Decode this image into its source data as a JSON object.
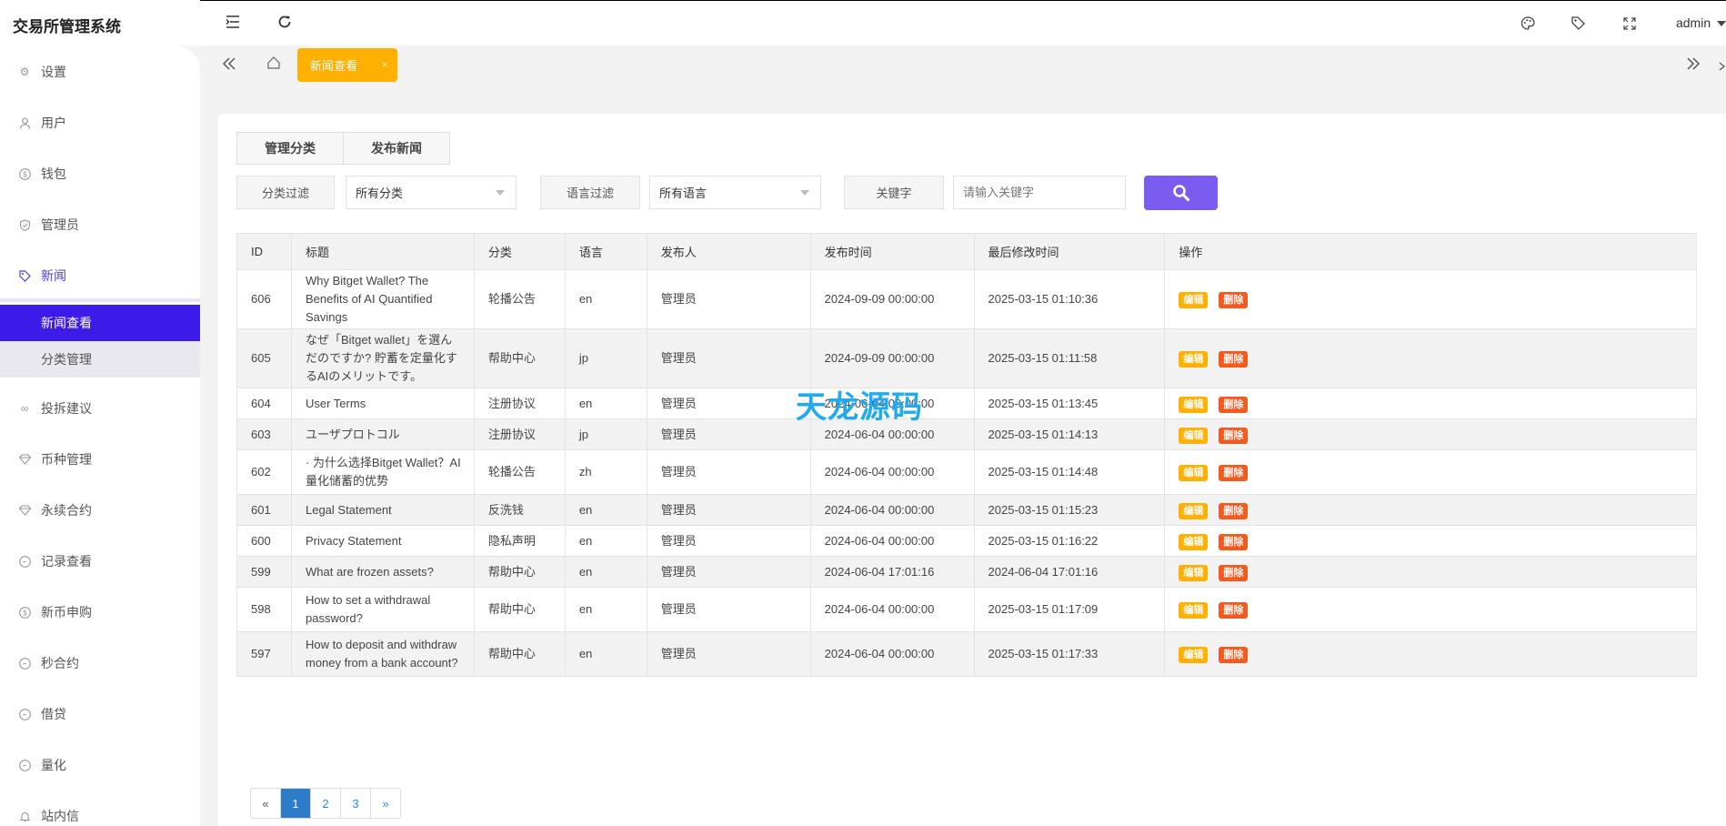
{
  "app": {
    "title": "交易所管理系统",
    "user": "admin"
  },
  "sidebar": {
    "items": [
      {
        "label": "设置",
        "icon": "gear-icon"
      },
      {
        "label": "用户",
        "icon": "user-icon"
      },
      {
        "label": "钱包",
        "icon": "dollar-icon"
      },
      {
        "label": "管理员",
        "icon": "shield-icon"
      },
      {
        "label": "新闻",
        "icon": "tag-icon"
      },
      {
        "label": "投拆建议",
        "icon": "link-icon"
      },
      {
        "label": "币种管理",
        "icon": "diamond-icon"
      },
      {
        "label": "永续合约",
        "icon": "diamond-icon"
      },
      {
        "label": "记录查看",
        "icon": "clock-icon"
      },
      {
        "label": "新币申购",
        "icon": "dollar-icon"
      },
      {
        "label": "秒合约",
        "icon": "clock-icon"
      },
      {
        "label": "借贷",
        "icon": "clock-icon"
      },
      {
        "label": "量化",
        "icon": "clock-icon"
      },
      {
        "label": "站内信",
        "icon": "bell-icon"
      }
    ],
    "news_sub": [
      "新闻查看",
      "分类管理"
    ]
  },
  "tabs": {
    "active": "新闻查看",
    "close": "×"
  },
  "actions": {
    "manage_category": "管理分类",
    "publish_news": "发布新闻"
  },
  "filters": {
    "category_label": "分类过滤",
    "category_value": "所有分类",
    "language_label": "语言过滤",
    "language_value": "所有语言",
    "keyword_label": "关键字",
    "keyword_placeholder": "请输入关键字"
  },
  "colors": {
    "accent": "#7b5cf0",
    "primary": "#3c1be8",
    "edit": "#ffb000",
    "delete": "#f45a1e"
  },
  "table": {
    "headers": [
      "ID",
      "标题",
      "分类",
      "语言",
      "发布人",
      "发布时间",
      "最后修改时间",
      "操作"
    ],
    "edit_label": "编辑",
    "delete_label": "删除",
    "rows": [
      {
        "id": "606",
        "title": "Why Bitget Wallet? The Benefits of AI Quantified Savings",
        "cat": "轮播公告",
        "lang": "en",
        "pub": "管理员",
        "time": "2024-09-09 00:00:00",
        "mod": "2025-03-15 01:10:36"
      },
      {
        "id": "605",
        "title": "なぜ「Bitget wallet」を選んだのですか? 貯蓄を定量化するAIのメリットです。",
        "cat": "帮助中心",
        "lang": "jp",
        "pub": "管理员",
        "time": "2024-09-09 00:00:00",
        "mod": "2025-03-15 01:11:58"
      },
      {
        "id": "604",
        "title": "User Terms",
        "cat": "注册协议",
        "lang": "en",
        "pub": "管理员",
        "time": "2024-06-04 00:00:00",
        "mod": "2025-03-15 01:13:45"
      },
      {
        "id": "603",
        "title": "ユーザプロトコル",
        "cat": "注册协议",
        "lang": "jp",
        "pub": "管理员",
        "time": "2024-06-04 00:00:00",
        "mod": "2025-03-15 01:14:13"
      },
      {
        "id": "602",
        "title": "· 为什么选择Bitget Wallet？AI量化储蓄的优势",
        "cat": "轮播公告",
        "lang": "zh",
        "pub": "管理员",
        "time": "2024-06-04 00:00:00",
        "mod": "2025-03-15 01:14:48"
      },
      {
        "id": "601",
        "title": "Legal Statement",
        "cat": "反洗钱",
        "lang": "en",
        "pub": "管理员",
        "time": "2024-06-04 00:00:00",
        "mod": "2025-03-15 01:15:23"
      },
      {
        "id": "600",
        "title": "Privacy Statement",
        "cat": "隐私声明",
        "lang": "en",
        "pub": "管理员",
        "time": "2024-06-04 00:00:00",
        "mod": "2025-03-15 01:16:22"
      },
      {
        "id": "599",
        "title": "What are frozen assets?",
        "cat": "帮助中心",
        "lang": "en",
        "pub": "管理员",
        "time": "2024-06-04 17:01:16",
        "mod": "2024-06-04 17:01:16"
      },
      {
        "id": "598",
        "title": "How to set a withdrawal password?",
        "cat": "帮助中心",
        "lang": "en",
        "pub": "管理员",
        "time": "2024-06-04 00:00:00",
        "mod": "2025-03-15 01:17:09"
      },
      {
        "id": "597",
        "title": "How to deposit and withdraw money from a bank account?",
        "cat": "帮助中心",
        "lang": "en",
        "pub": "管理员",
        "time": "2024-06-04 00:00:00",
        "mod": "2025-03-15 01:17:33"
      }
    ]
  },
  "pagination": {
    "prev": "«",
    "pages": [
      "1",
      "2",
      "3"
    ],
    "next": "»",
    "current": "1"
  },
  "watermark": "天龙源码"
}
